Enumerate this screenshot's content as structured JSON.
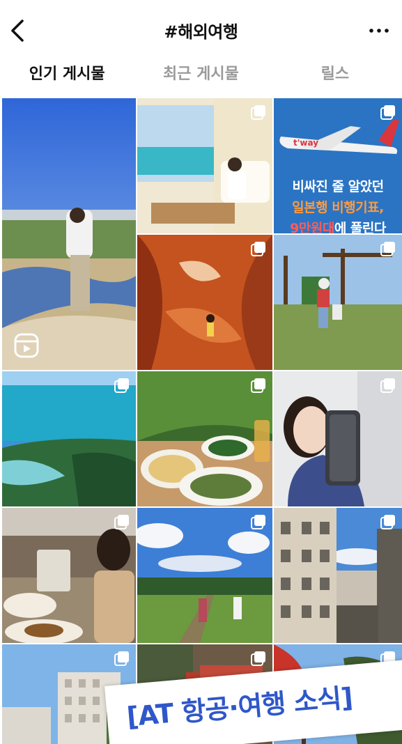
{
  "header": {
    "title": "#해외여행",
    "back_icon": "chevron-left-icon",
    "more_icon": "more-horizontal-icon"
  },
  "tabs": [
    {
      "label": "인기 게시물",
      "active": true
    },
    {
      "label": "최근 게시물",
      "active": false
    },
    {
      "label": "릴스",
      "active": false
    }
  ],
  "grid": {
    "ad": {
      "airline_logo": "t'way",
      "line1": "비싸진 줄 알았던",
      "line2": "일본행 비행기표,",
      "line3a": "9만원대",
      "line3b": "에 풀린다"
    }
  },
  "banner": {
    "text": "[AT 항공·여행 소식]"
  },
  "colors": {
    "background": "#ffffff",
    "inactive_tab": "#9a9a9a",
    "banner_text": "#2f57c9",
    "ad_orange": "#ff9a3c",
    "ad_red": "#ff5b5b"
  }
}
